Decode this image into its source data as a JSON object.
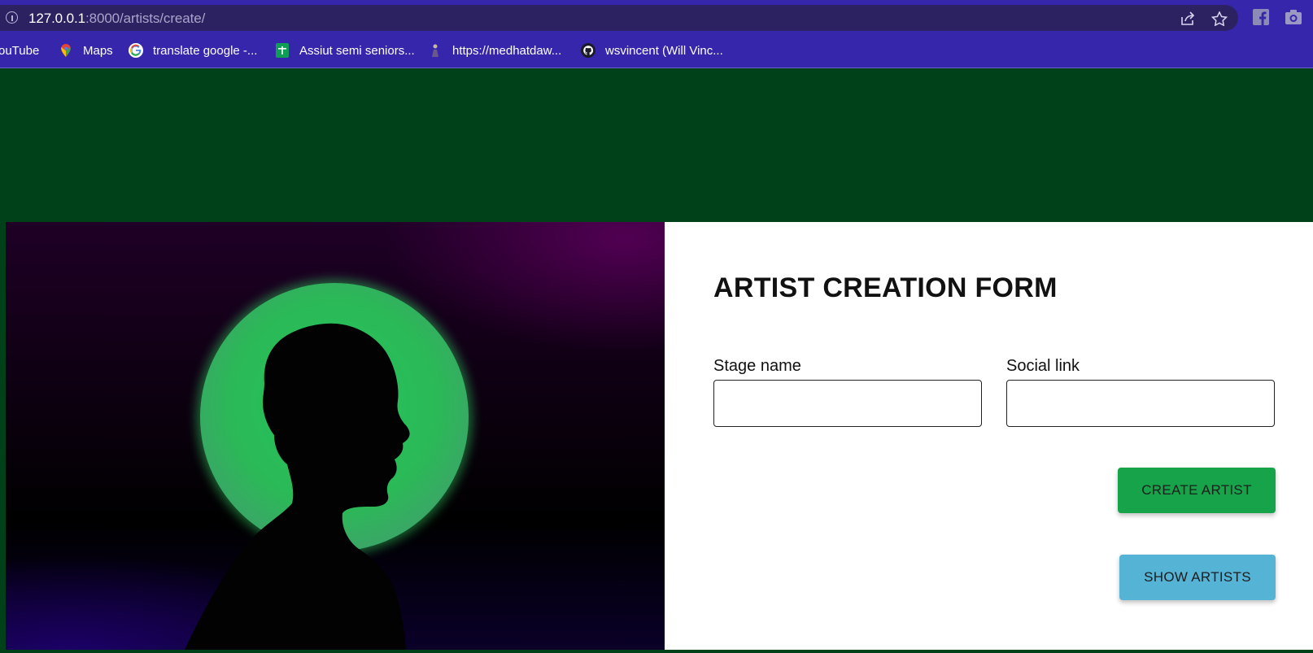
{
  "browser": {
    "url_host": "127.0.0.1",
    "url_path": ":8000/artists/create/",
    "bookmarks": [
      {
        "label": "ouTube",
        "icon": "youtube-icon"
      },
      {
        "label": "Maps",
        "icon": "maps-pin-icon"
      },
      {
        "label": "translate google -...",
        "icon": "google-icon"
      },
      {
        "label": "Assiut semi seniors...",
        "icon": "sheets-icon"
      },
      {
        "label": "https://medhatdaw...",
        "icon": "site-icon"
      },
      {
        "label": "wsvincent (Will Vinc...",
        "icon": "github-icon"
      }
    ]
  },
  "page": {
    "background_color": "#00411a",
    "hero_image": "artist-silhouette-image"
  },
  "form": {
    "title": "ARTIST CREATION FORM",
    "stage_name_label": "Stage name",
    "stage_name_value": "",
    "social_link_label": "Social link",
    "social_link_value": "",
    "create_button": "CREATE ARTIST",
    "show_button": "SHOW ARTISTS"
  },
  "colors": {
    "create_button": "#16a34a",
    "show_button": "#55b3d6",
    "circle_green": "#2dba55",
    "chrome_purple": "#3626ac"
  }
}
